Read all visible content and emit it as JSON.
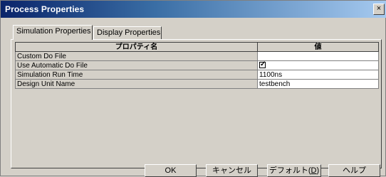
{
  "window": {
    "title": "Process Properties",
    "close_label": "×"
  },
  "tabs": [
    {
      "label": "Simulation Properties",
      "active": true
    },
    {
      "label": "Display Properties",
      "active": false
    }
  ],
  "grid": {
    "headers": [
      "プロパティ名",
      "値"
    ],
    "rows": [
      {
        "name": "Custom Do File",
        "value": ""
      },
      {
        "name": "Use Automatic Do File",
        "value": "",
        "checked": true
      },
      {
        "name": "Simulation Run Time",
        "value": "1100ns"
      },
      {
        "name": "Design Unit Name",
        "value": "testbench"
      }
    ]
  },
  "buttons": {
    "ok": "OK",
    "cancel": "キャンセル",
    "default_prefix": "デフォルト(",
    "default_mnemonic": "D",
    "default_suffix": ")",
    "help": "ヘルプ"
  },
  "colors": {
    "title_bar_start": "#0a246a",
    "face": "#d4d0c8"
  }
}
